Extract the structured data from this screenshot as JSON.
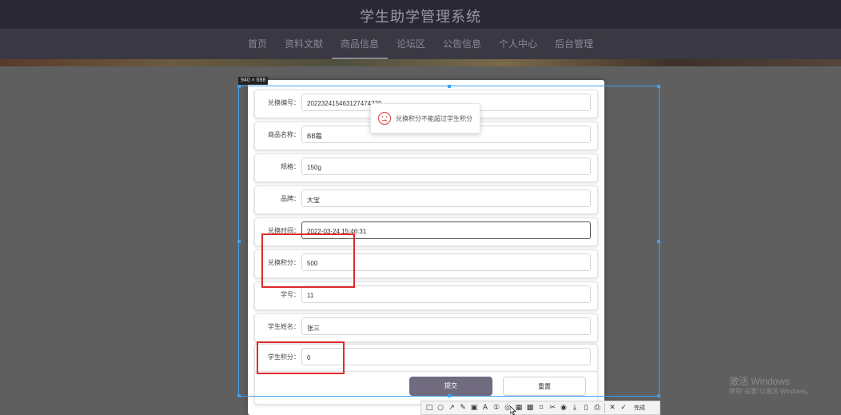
{
  "site": {
    "title": "学生助学管理系统"
  },
  "nav": {
    "items": [
      {
        "label": "首页"
      },
      {
        "label": "资料文献"
      },
      {
        "label": "商品信息"
      },
      {
        "label": "论坛区"
      },
      {
        "label": "公告信息"
      },
      {
        "label": "个人中心"
      },
      {
        "label": "后台管理"
      }
    ]
  },
  "form": {
    "fields": [
      {
        "label": "兑换编号：",
        "value": "20223241546312747427​0"
      },
      {
        "label": "商品名称：",
        "value": "BB霜"
      },
      {
        "label": "规格：",
        "value": "150g"
      },
      {
        "label": "品牌：",
        "value": "大宝"
      },
      {
        "label": "兑换时间：",
        "value": "2022-03-24 15:46:31"
      },
      {
        "label": "兑换积分：",
        "value": "500"
      },
      {
        "label": "学号：",
        "value": "11"
      },
      {
        "label": "学生姓名：",
        "value": "张三"
      },
      {
        "label": "学生积分：",
        "value": "0"
      }
    ],
    "submit_label": "提交",
    "reset_label": "重置"
  },
  "toast": {
    "message": "兑换积分不能超过学生积分",
    "icon": "sad-face-icon"
  },
  "capture": {
    "size_label": "940 × 698",
    "tools": [
      "□",
      "○",
      "↗",
      "✎",
      "▣",
      "A",
      "①",
      "◎",
      "▦",
      "▩",
      "⌗",
      "✂",
      "◉",
      "⤓",
      "▯",
      "⎙",
      "✕",
      "✓"
    ],
    "done_label": "完成"
  },
  "watermark": {
    "line1": "激活 Windows",
    "line2": "转到\"设置\"以激活 Windows。"
  },
  "colors": {
    "accent": "#716b80",
    "selection": "#3ea0f0",
    "highlight": "#e02a2a"
  }
}
